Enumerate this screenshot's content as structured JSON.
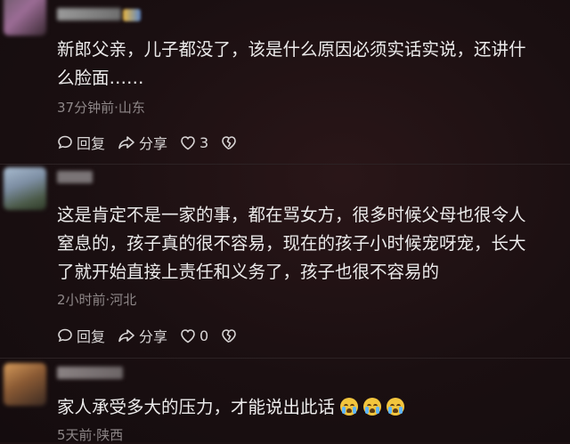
{
  "comments": [
    {
      "text_line1": "新郎父亲，儿子都没了，该是什么原因必须实话实说，还讲什",
      "text_line2": "么脸面……",
      "meta": "37分钟前·山东",
      "reply_label": "回复",
      "share_label": "分享",
      "like_count": "3"
    },
    {
      "text_line1": "这是肯定不是一家的事，都在骂女方，很多时候父母也很令人",
      "text_line2": "窒息的，孩子真的很不容易，现在的孩子小时候宠呀宠，长大",
      "text_line3": "了就开始直接上责任和义务了，孩子也很不容易的",
      "meta": "2小时前·河北",
      "reply_label": "回复",
      "share_label": "分享",
      "like_count": "0"
    },
    {
      "text_line1": "家人承受多大的压力，才能说出此话",
      "meta": "5天前·陕西",
      "emojis": [
        "crying-face",
        "crying-face",
        "crying-face"
      ]
    }
  ],
  "colors": {
    "background": "#1c1012",
    "text": "#ecebeb",
    "meta": "#8e8788"
  }
}
